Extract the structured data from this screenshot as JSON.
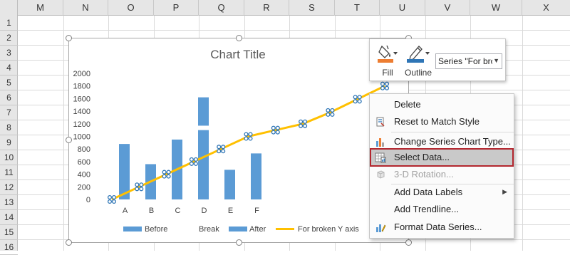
{
  "sheet": {
    "columns": [
      "M",
      "N",
      "O",
      "P",
      "Q",
      "R",
      "S",
      "T",
      "U",
      "V",
      "W",
      "X"
    ],
    "rows": [
      "1",
      "2",
      "3",
      "4",
      "5",
      "6",
      "7",
      "8",
      "9",
      "10",
      "11",
      "12",
      "13",
      "14",
      "15",
      "16"
    ]
  },
  "chart": {
    "title": "Chart Title",
    "legend": [
      "Before",
      "Break",
      "After",
      "For broken Y axis"
    ],
    "colors": {
      "bar": "#5b9bd5",
      "line": "#ffc000",
      "marker": "#2e75b6",
      "selected_border": "#b3262e"
    }
  },
  "chart_data": {
    "type": "bar",
    "categories": [
      "A",
      "B",
      "C",
      "D",
      "E",
      "F"
    ],
    "y_ticks": [
      "0",
      "200",
      "400",
      "600",
      "800",
      "1000",
      "1200",
      "1400",
      "1600",
      "1800",
      "2000"
    ],
    "ylim": [
      0,
      2000
    ],
    "series": [
      {
        "name": "Before",
        "values": [
          880,
          560,
          950,
          1100,
          470,
          730
        ]
      },
      {
        "name": "Break",
        "values": [
          0,
          0,
          0,
          70,
          0,
          0
        ]
      },
      {
        "name": "After",
        "values": [
          0,
          0,
          0,
          450,
          0,
          0
        ]
      },
      {
        "name": "For broken Y axis",
        "kind": "line",
        "x": [
          0,
          1,
          2,
          3,
          4,
          5,
          6,
          7,
          8,
          9,
          10
        ],
        "values": [
          0,
          200,
          400,
          600,
          800,
          1000,
          1100,
          1200,
          1380,
          1590,
          1800
        ]
      }
    ],
    "legend_position": "bottom"
  },
  "toolbar": {
    "fill_label": "Fill",
    "outline_label": "Outline",
    "series_value": "Series \"For brol"
  },
  "menu": {
    "items": [
      {
        "label": "Delete",
        "icon": "none"
      },
      {
        "label": "Reset to Match Style",
        "icon": "reset-style-icon"
      },
      {
        "label": "Change Series Chart Type...",
        "icon": "chart-type-icon"
      },
      {
        "label": "Select Data...",
        "icon": "select-data-icon"
      },
      {
        "label": "3-D Rotation...",
        "icon": "rotation-3d-icon"
      },
      {
        "label": "Add Data Labels",
        "icon": "none"
      },
      {
        "label": "Add Trendline...",
        "icon": "none"
      },
      {
        "label": "Format Data Series...",
        "icon": "format-series-icon"
      }
    ]
  }
}
